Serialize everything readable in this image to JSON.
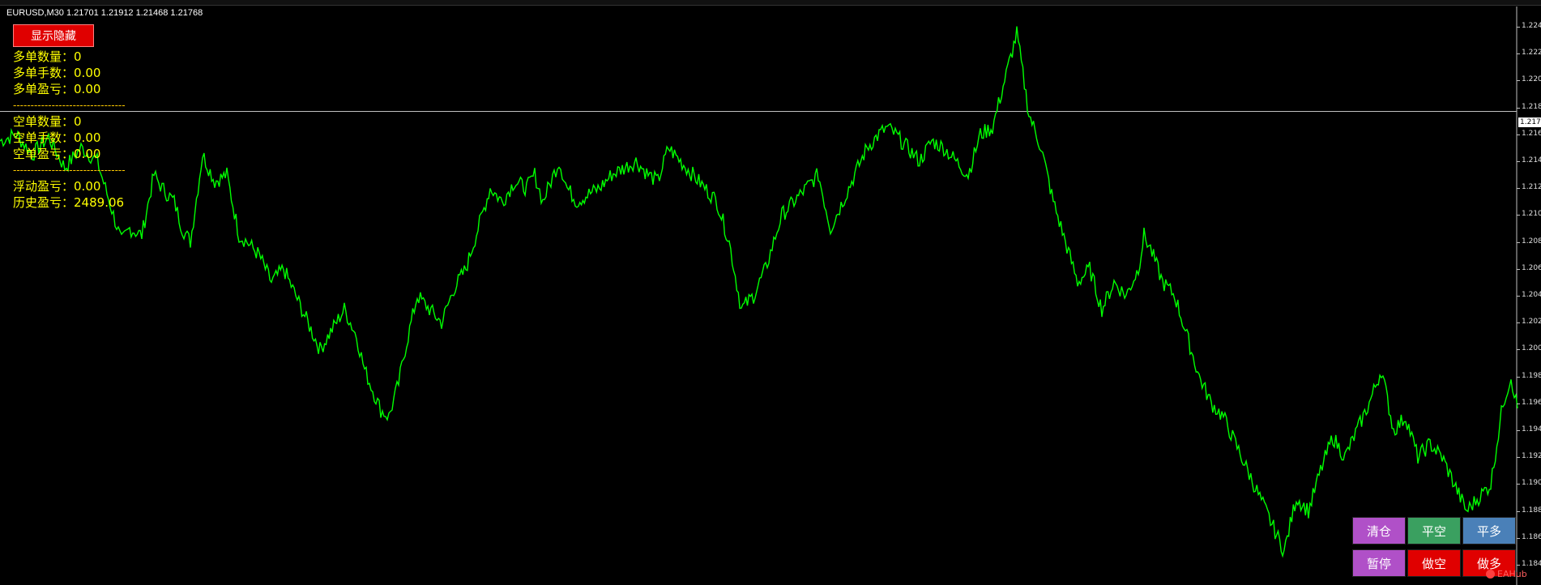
{
  "chart_header": {
    "symbol": "EURUSD,M30",
    "ohlc": "1.21701 1.21912 1.21468 1.21768"
  },
  "toggle_button": {
    "label": "显示隐藏",
    "color": "#e00000"
  },
  "stats": {
    "long_count_label": "多单数量：",
    "long_count": "0",
    "long_lots_label": "多单手数：",
    "long_lots": "0.00",
    "long_pnl_label": "多单盈亏：",
    "long_pnl": "0.00",
    "separator": "--------------------------------",
    "short_count_label": "空单数量：",
    "short_count": "0",
    "short_lots_label": "空单手数：",
    "short_lots": "0.00",
    "short_pnl_label": "空单盈亏：",
    "short_pnl": "0.00",
    "floating_pnl_label": "浮动盈亏：",
    "floating_pnl": "0.00",
    "history_pnl_label": "历史盈亏：",
    "history_pnl": "2489.06"
  },
  "trade_buttons": {
    "clear_all": {
      "label": "清仓",
      "color": "#b050c8"
    },
    "close_short": {
      "label": "平空",
      "color": "#3aa060"
    },
    "close_long": {
      "label": "平多",
      "color": "#4a80b8"
    },
    "pause": {
      "label": "暂停",
      "color": "#b050c8"
    },
    "open_short": {
      "label": "做空",
      "color": "#e00000"
    },
    "open_long": {
      "label": "做多",
      "color": "#e00000"
    }
  },
  "price_axis": {
    "ticks": [
      "1.224",
      "1.222",
      "1.220",
      "1.218",
      "1.216",
      "1.214",
      "1.212",
      "1.210",
      "1.208",
      "1.206",
      "1.204",
      "1.202",
      "1.200",
      "1.198",
      "1.196",
      "1.194",
      "1.192",
      "1.190",
      "1.188",
      "1.186",
      "1.184"
    ],
    "current": "1.217"
  },
  "watermark": "EAHub",
  "chart_data": {
    "type": "candlestick-line",
    "symbol": "EURUSD",
    "timeframe": "M30",
    "ylim": [
      1.1825,
      1.2255
    ],
    "current_price": 1.2177,
    "line_color": "#00ff00",
    "x": [
      0,
      20,
      40,
      60,
      80,
      100,
      120,
      140,
      150,
      160,
      175,
      190,
      200,
      215,
      225,
      235,
      250,
      265,
      280,
      295,
      305,
      320,
      335,
      350,
      365,
      380,
      395,
      410,
      425,
      440,
      450,
      460,
      470,
      480,
      492,
      500,
      515,
      530,
      545,
      560,
      575,
      590,
      605,
      620,
      635,
      650,
      660,
      670,
      680,
      690,
      700,
      712,
      725,
      740,
      755,
      770,
      785,
      800,
      812,
      825,
      840,
      855,
      870,
      885,
      900,
      915,
      930,
      945,
      955,
      965,
      980,
      995,
      1010,
      1025,
      1040,
      1055,
      1070,
      1085,
      1095,
      1105,
      1120,
      1135,
      1150,
      1165,
      1180,
      1195,
      1210,
      1225,
      1240,
      1255,
      1270,
      1285,
      1300,
      1315,
      1330,
      1345,
      1360,
      1375,
      1390,
      1405,
      1412,
      1420,
      1435,
      1450,
      1465,
      1480,
      1495,
      1510,
      1525,
      1540,
      1555,
      1570,
      1585,
      1600,
      1615,
      1630,
      1645,
      1660,
      1675,
      1690,
      1705,
      1720,
      1735,
      1750,
      1765,
      1780,
      1795,
      1810,
      1825,
      1840,
      1855,
      1865,
      1875
    ],
    "y": [
      1.2155,
      1.216,
      1.2145,
      1.2158,
      1.2135,
      1.215,
      1.214,
      1.21,
      1.208,
      1.209,
      1.2085,
      1.213,
      1.212,
      1.211,
      1.209,
      1.208,
      1.2145,
      1.2125,
      1.213,
      1.2085,
      1.208,
      1.207,
      1.205,
      1.206,
      1.204,
      1.202,
      1.2,
      1.2015,
      1.203,
      1.201,
      1.1985,
      1.197,
      1.1955,
      1.195,
      1.1975,
      1.2,
      1.204,
      1.203,
      1.202,
      1.2045,
      1.206,
      1.209,
      1.212,
      1.211,
      1.2125,
      1.212,
      1.213,
      1.211,
      1.2125,
      1.214,
      1.212,
      1.211,
      1.2115,
      1.212,
      1.213,
      1.2135,
      1.214,
      1.213,
      1.2125,
      1.215,
      1.214,
      1.213,
      1.212,
      1.211,
      1.208,
      1.203,
      1.204,
      1.206,
      1.208,
      1.21,
      1.211,
      1.212,
      1.213,
      1.209,
      1.211,
      1.213,
      1.215,
      1.216,
      1.2165,
      1.216,
      1.215,
      1.214,
      1.2155,
      1.215,
      1.214,
      1.213,
      1.216,
      1.2165,
      1.22,
      1.2235,
      1.2175,
      1.215,
      1.211,
      1.208,
      1.205,
      1.206,
      1.203,
      1.205,
      1.204,
      1.206,
      1.2085,
      1.2075,
      1.205,
      1.204,
      1.201,
      1.198,
      1.196,
      1.195,
      1.193,
      1.191,
      1.189,
      1.187,
      1.185,
      1.189,
      1.188,
      1.191,
      1.1935,
      1.192,
      1.194,
      1.196,
      1.1985,
      1.194,
      1.195,
      1.192,
      1.193,
      1.192,
      1.19,
      1.188,
      1.189,
      1.19,
      1.196,
      1.198,
      1.195,
      1.194
    ]
  }
}
